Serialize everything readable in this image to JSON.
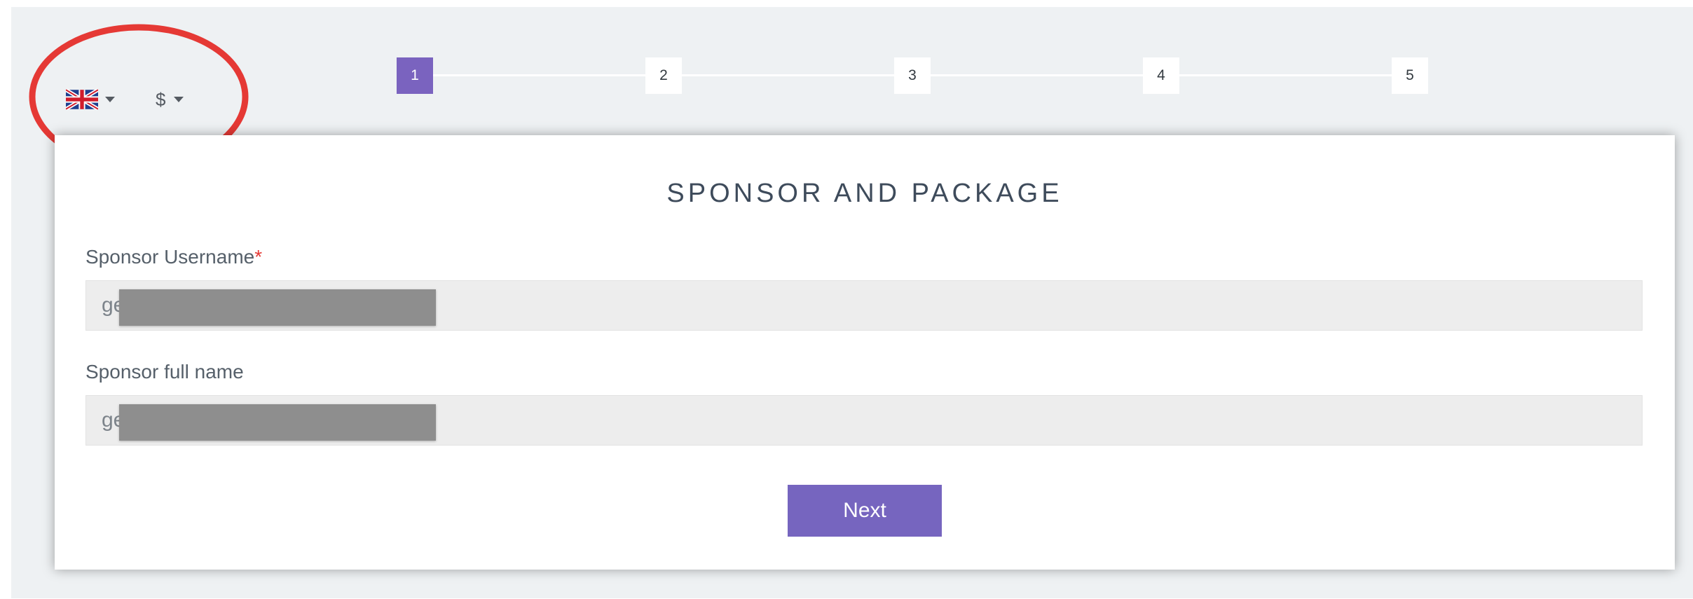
{
  "header": {
    "language": {
      "icon": "uk-flag-icon",
      "selected": "English"
    },
    "currency": {
      "symbol": "$"
    }
  },
  "steps": [
    "1",
    "2",
    "3",
    "4",
    "5"
  ],
  "active_step": 1,
  "form": {
    "title": "SPONSOR AND PACKAGE",
    "sponsor_username": {
      "label": "Sponsor Username",
      "required_mark": "*",
      "value_visible": "ge"
    },
    "sponsor_full_name": {
      "label": "Sponsor full name",
      "value_visible": "ge"
    },
    "next_label": "Next"
  },
  "colors": {
    "accent": "#7665bf",
    "annotation": "#e53935",
    "page_background": "#eef1f3"
  }
}
